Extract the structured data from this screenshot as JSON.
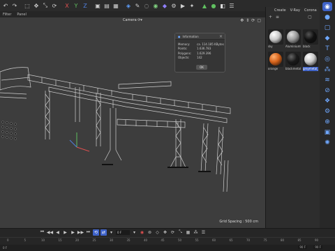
{
  "menu": [
    "Filter",
    "Panel"
  ],
  "viewport": {
    "camera_label": "Camera ⟳▾",
    "grid_spacing": "Grid Spacing : 500 cm"
  },
  "info": {
    "title": "Information",
    "rows": [
      {
        "key": "Memory:",
        "value": "ca. 114.185 KBytes"
      },
      {
        "key": "Points:",
        "value": "1.636.783"
      },
      {
        "key": "Polygons:",
        "value": "1.629.396"
      },
      {
        "key": "Objects:",
        "value": "142"
      }
    ],
    "ok_label": "OK"
  },
  "panel": {
    "menu": [
      "Create",
      "V-Ray",
      "Corona"
    ],
    "materials": [
      {
        "label": "sky",
        "color": "#c9c9c9",
        "hi": "#ffffff"
      },
      {
        "label": "Aluminiumtrest",
        "color": "#9a9a9a",
        "hi": "#e0e0e0"
      },
      {
        "label": "black",
        "color": "#111111",
        "hi": "#555555"
      },
      {
        "label": "orange",
        "color": "#d5621a",
        "hi": "#ffb070"
      },
      {
        "label": "blackmetal",
        "color": "#1a1a1a",
        "hi": "#666666"
      },
      {
        "label": "greymetal_c",
        "color": "#c8c8c8",
        "hi": "#ffffff",
        "selected": true
      }
    ]
  },
  "timeline": {
    "frame_field": "0 F",
    "ruler": [
      "0",
      "5",
      "10",
      "15",
      "20",
      "25",
      "30",
      "35",
      "40",
      "45",
      "50",
      "55",
      "60",
      "65",
      "70",
      "75",
      "80",
      "85",
      "90"
    ],
    "start_frame": "0 F",
    "end_frame_a": "90 F",
    "end_frame_b": "90 F"
  },
  "colors": {
    "accent": "#3f63c9",
    "viewport": "#3d3d3d"
  }
}
